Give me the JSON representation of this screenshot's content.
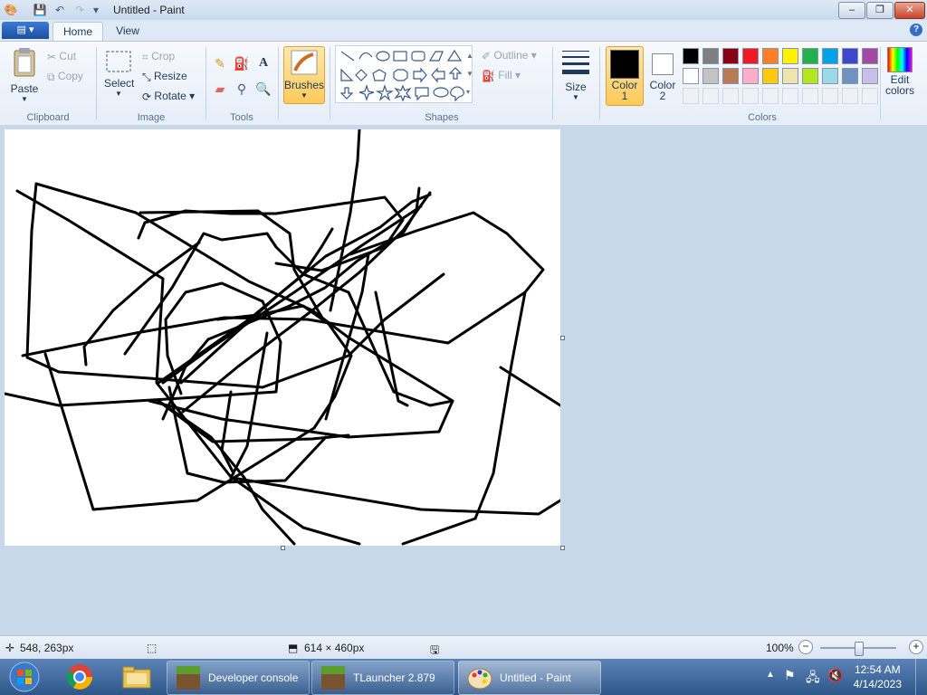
{
  "window": {
    "title": "Untitled - Paint"
  },
  "tabs": {
    "home": "Home",
    "view": "View"
  },
  "clipboard": {
    "paste": "Paste",
    "cut": "Cut",
    "copy": "Copy",
    "label": "Clipboard"
  },
  "image": {
    "select": "Select",
    "crop": "Crop",
    "resize": "Resize",
    "rotate": "Rotate",
    "label": "Image"
  },
  "tools": {
    "label": "Tools"
  },
  "brushes": {
    "label": "Brushes"
  },
  "shapes": {
    "outline": "Outline",
    "fill": "Fill",
    "label": "Shapes"
  },
  "size": {
    "label": "Size"
  },
  "color1": {
    "line1": "Color",
    "line2": "1",
    "value": "#000000"
  },
  "color2": {
    "line1": "Color",
    "line2": "2",
    "value": "#ffffff"
  },
  "colors": {
    "label": "Colors",
    "edit_line1": "Edit",
    "edit_line2": "colors",
    "row1": [
      "#000000",
      "#7f7f7f",
      "#880015",
      "#ed1c24",
      "#ff7f27",
      "#fff200",
      "#22b14c",
      "#00a2e8",
      "#3f48cc",
      "#a349a4"
    ],
    "row2": [
      "#ffffff",
      "#c3c3c3",
      "#b97a57",
      "#ffaec9",
      "#ffc90e",
      "#efe4b0",
      "#b5e61d",
      "#99d9ea",
      "#7092be",
      "#c8bfe7"
    ]
  },
  "status": {
    "cursor_pos": "548, 263px",
    "canvas_size": "614 × 460px",
    "zoom": "100%",
    "zoom_fraction": 0.5
  },
  "taskbar": {
    "items": [
      "Developer console",
      "TLauncher 2.879",
      "Untitled - Paint"
    ],
    "time": "12:54 AM",
    "date": "4/14/2023"
  }
}
